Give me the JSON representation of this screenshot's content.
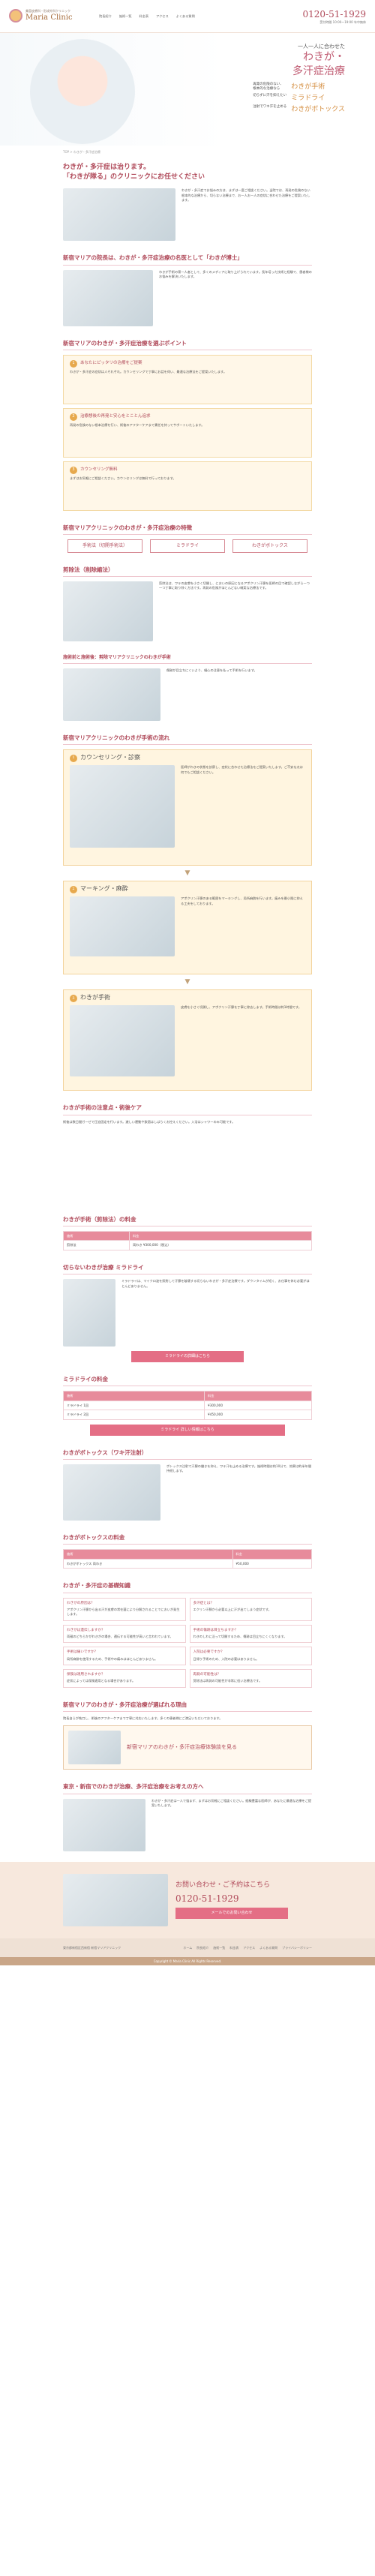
{
  "header": {
    "logo_sub": "美容皮膚科・形成外科クリニック",
    "logo_name": "Maria Clinic",
    "nav": [
      "院長紹介",
      "施術一覧",
      "料金表",
      "アクセス",
      "よくある質問"
    ],
    "tel": "0120-51-1929",
    "tel_note": "受付時間 10:00～19:00 年中無休"
  },
  "hero": {
    "lead": "一人一人に合わせた",
    "title": "わきが・\n多汗症治療",
    "items": [
      {
        "label": "再発の危険のない、\n根本的な治療なら",
        "em": "わきが手術"
      },
      {
        "label": "切らずに汗を抑えたい",
        "em": "ミラドライ"
      },
      {
        "label": "注射でワキ汗を止める",
        "em": "わきがボトックス"
      }
    ]
  },
  "breadcrumb": "TOP > わきが・多汗症治療",
  "intro": {
    "title": "わきが・多汗症は治ります。\n「わきが隊る」のクリニックにお任せください",
    "text": "わきが・多汗症でお悩みの方は、まずは一度ご相談ください。当院では、再発の危険のない根本的な治療から、切らない治療まで、お一人お一人の症状に合わせた治療をご提案いたします。"
  },
  "doctor": {
    "title": "新宿マリアの院長は、わきが・多汗症治療の名医として「わきが博士」",
    "text": "わきが手術の第一人者として、多くのメディアに取り上げられています。長年培った技術と経験で、患者様のお悩みを解決いたします。"
  },
  "points": {
    "title": "新宿マリアのわきが・多汗症治療を選ぶポイント",
    "items": [
      {
        "n": "1",
        "head": "あなたにピッタリの治療をご提案",
        "text": "わきが・多汗症の症状は人それぞれ。カウンセリングで丁寧にお話を伺い、最適な治療法をご提案いたします。"
      },
      {
        "n": "2",
        "head": "治療想後の再発と安心をとことん追求",
        "text": "再発の危険のない根本治療を行い、術後のアフターケアまで責任を持ってサポートいたします。"
      },
      {
        "n": "3",
        "head": "カウンセリング無料",
        "text": "まずはお気軽にご相談ください。カウンセリングは無料で行っております。"
      }
    ]
  },
  "features": {
    "title": "新宿マリアクリニックのわきが・多汗症治療の特徴",
    "tabs": [
      "手術法（切開手術法）",
      "ミラドライ",
      "わきがボトックス"
    ]
  },
  "surgery": {
    "title": "剪除法（削除縮法）",
    "text": "剪除法は、ワキの皮膚を小さく切開し、においの原因となるアポクリン汗腺を医師の目で確認しながら一つ一つ丁寧に取り除く方法です。再発の危険がほとんどない確実な治療法です。",
    "sub_title": "施術前と施術後：剪除マリアクリニックのわきが手術",
    "sub_text": "傷跡が目立ちにくいよう、細心の注意を払って手術を行います。"
  },
  "flow": {
    "title": "新宿マリアクリニックのわきが手術の流れ",
    "steps": [
      {
        "n": "1",
        "head": "カウンセリング・診察",
        "text": "医師がわきの状態を診察し、症状に合わせた治療法をご提案いたします。ご不安な点は何でもご相談ください。"
      },
      {
        "n": "2",
        "head": "マーキング・麻酔",
        "text": "アポクリン汗腺のある範囲をマーキングし、局所麻酔を行います。痛みを最小限に抑える工夫をしております。"
      },
      {
        "n": "3",
        "head": "わきが手術",
        "text": "皮膚を小さく切開し、アポクリン汗腺を丁寧に除去します。手術時間は約1時間です。"
      }
    ]
  },
  "aftercare": {
    "title": "わきが手術の注意点・術後ケア",
    "text": "術後は数日間ガーゼで圧迫固定を行います。激しい運動や飲酒はしばらくお控えください。入浴はシャワーのみ可能です。"
  },
  "price1": {
    "title": "わきが手術（剪除法）の料金",
    "head": [
      "施術",
      "料金"
    ],
    "rows": [
      [
        "剪除法",
        "両わき ¥300,000（税込）"
      ]
    ]
  },
  "miradry": {
    "title": "切らないわきが治療 ミラドライ",
    "text": "ミラドライは、マイクロ波を照射して汗腺を破壊する切らないわきが・多汗症治療です。ダウンタイムが短く、お仕事を休む必要がほとんどありません。",
    "button": "ミラドライの詳細はこちら"
  },
  "price2": {
    "title": "ミラドライの料金",
    "head": [
      "施術",
      "料金"
    ],
    "rows": [
      [
        "ミラドライ 1回",
        "¥300,000"
      ],
      [
        "ミラドライ 2回",
        "¥450,000"
      ]
    ],
    "button": "ミラドライ 詳しい情報はこちら"
  },
  "botox": {
    "title": "わきがボトックス（ワキ汗注射）",
    "text": "ボトックス注射で汗腺の働きを抑え、ワキ汗を止める治療です。施術時間は約10分で、効果は約半年間持続します。"
  },
  "price3": {
    "title": "わきがボトックスの料金",
    "head": [
      "施術",
      "料金"
    ],
    "rows": [
      [
        "わきがボトックス 両わき",
        "¥50,000"
      ]
    ]
  },
  "faq": {
    "title": "わきが・多汗症の基礎知識",
    "items": [
      {
        "q": "わきがの原因は？",
        "a": "アポクリン汗腺から出る汗が皮膚の常在菌により分解されることでにおいが発生します。"
      },
      {
        "q": "多汗症とは？",
        "a": "エクリン汗腺から必要以上に汗が出てしまう症状です。"
      },
      {
        "q": "わきがは遺伝しますか？",
        "a": "両親のどちらかがわきがの場合、遺伝する可能性が高いと言われています。"
      },
      {
        "q": "手術の傷跡は目立ちますか？",
        "a": "わきのしわに沿って切開するため、傷跡は目立ちにくくなります。"
      },
      {
        "q": "手術は痛いですか？",
        "a": "局所麻酔を使用するため、手術中の痛みはほとんどありません。"
      },
      {
        "q": "入院は必要ですか？",
        "a": "日帰り手術のため、入院の必要はありません。"
      },
      {
        "q": "保険は適用されますか？",
        "a": "症状によっては保険適用となる場合があります。"
      },
      {
        "q": "再発の可能性は？",
        "a": "剪除法は再発の可能性が非常に低い治療法です。"
      }
    ]
  },
  "reasons": {
    "title": "新宿マリアのわきが・多汗症治療が選ばれる理由",
    "text": "院長自らが執刀し、術後のアフターケアまで丁寧に対応いたします。多くの患者様にご満足いただいております。",
    "banner": "新宿マリアのわきが・多汗症治療体験談を見る"
  },
  "closing": {
    "title": "東京・新宿でのわきが治療、多汗症治療をお考えの方へ",
    "text": "わきが・多汗症は一人で悩まず、まずはお気軽にご相談ください。経験豊富な医師が、あなたに最適な治療をご提案いたします。"
  },
  "contact": {
    "title": "お問い合わせ・ご予約はこちら",
    "tel": "0120-51-1929",
    "button": "メールでのお問い合わせ"
  },
  "footer": {
    "address": "東京都新宿区西新宿 新宿マリアクリニック",
    "links": [
      "ホーム",
      "院長紹介",
      "施術一覧",
      "料金表",
      "アクセス",
      "よくある質問",
      "プライバシーポリシー"
    ],
    "copyright": "Copyright © Maria Clinic All Rights Reserved."
  }
}
